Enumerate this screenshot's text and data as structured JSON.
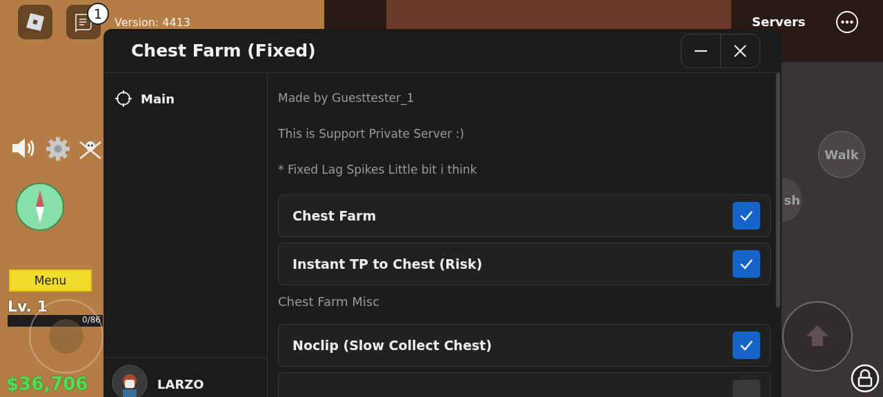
{
  "hud": {
    "notification_count": "1",
    "version": "Version: 4413",
    "servers": "Servers",
    "menu": "Menu",
    "level": "Lv. 1",
    "xp": {
      "reading": "0/86",
      "level": 0
    },
    "money": "$36,706",
    "walk": "Walk",
    "dash": "sh"
  },
  "window": {
    "title": "Chest Farm (Fixed)",
    "sidebar": {
      "tabs": [
        {
          "label": "Main",
          "selected": true
        }
      ],
      "user": "LARZO"
    },
    "items": [
      {
        "kind": "text",
        "text": "Made by Guesttester_1"
      },
      {
        "kind": "text",
        "text": "This is Support Private Server :)"
      },
      {
        "kind": "text",
        "text": "* Fixed Lag Spikes Little bit i think"
      },
      {
        "kind": "toggle",
        "label": "Chest Farm",
        "checked": true
      },
      {
        "kind": "toggle",
        "label": "Instant TP to Chest (Risk)",
        "checked": true
      },
      {
        "kind": "section",
        "text": "Chest Farm Misc"
      },
      {
        "kind": "toggle",
        "label": "Noclip (Slow Collect Chest)",
        "checked": true
      },
      {
        "kind": "toggle",
        "checked": false
      }
    ]
  }
}
